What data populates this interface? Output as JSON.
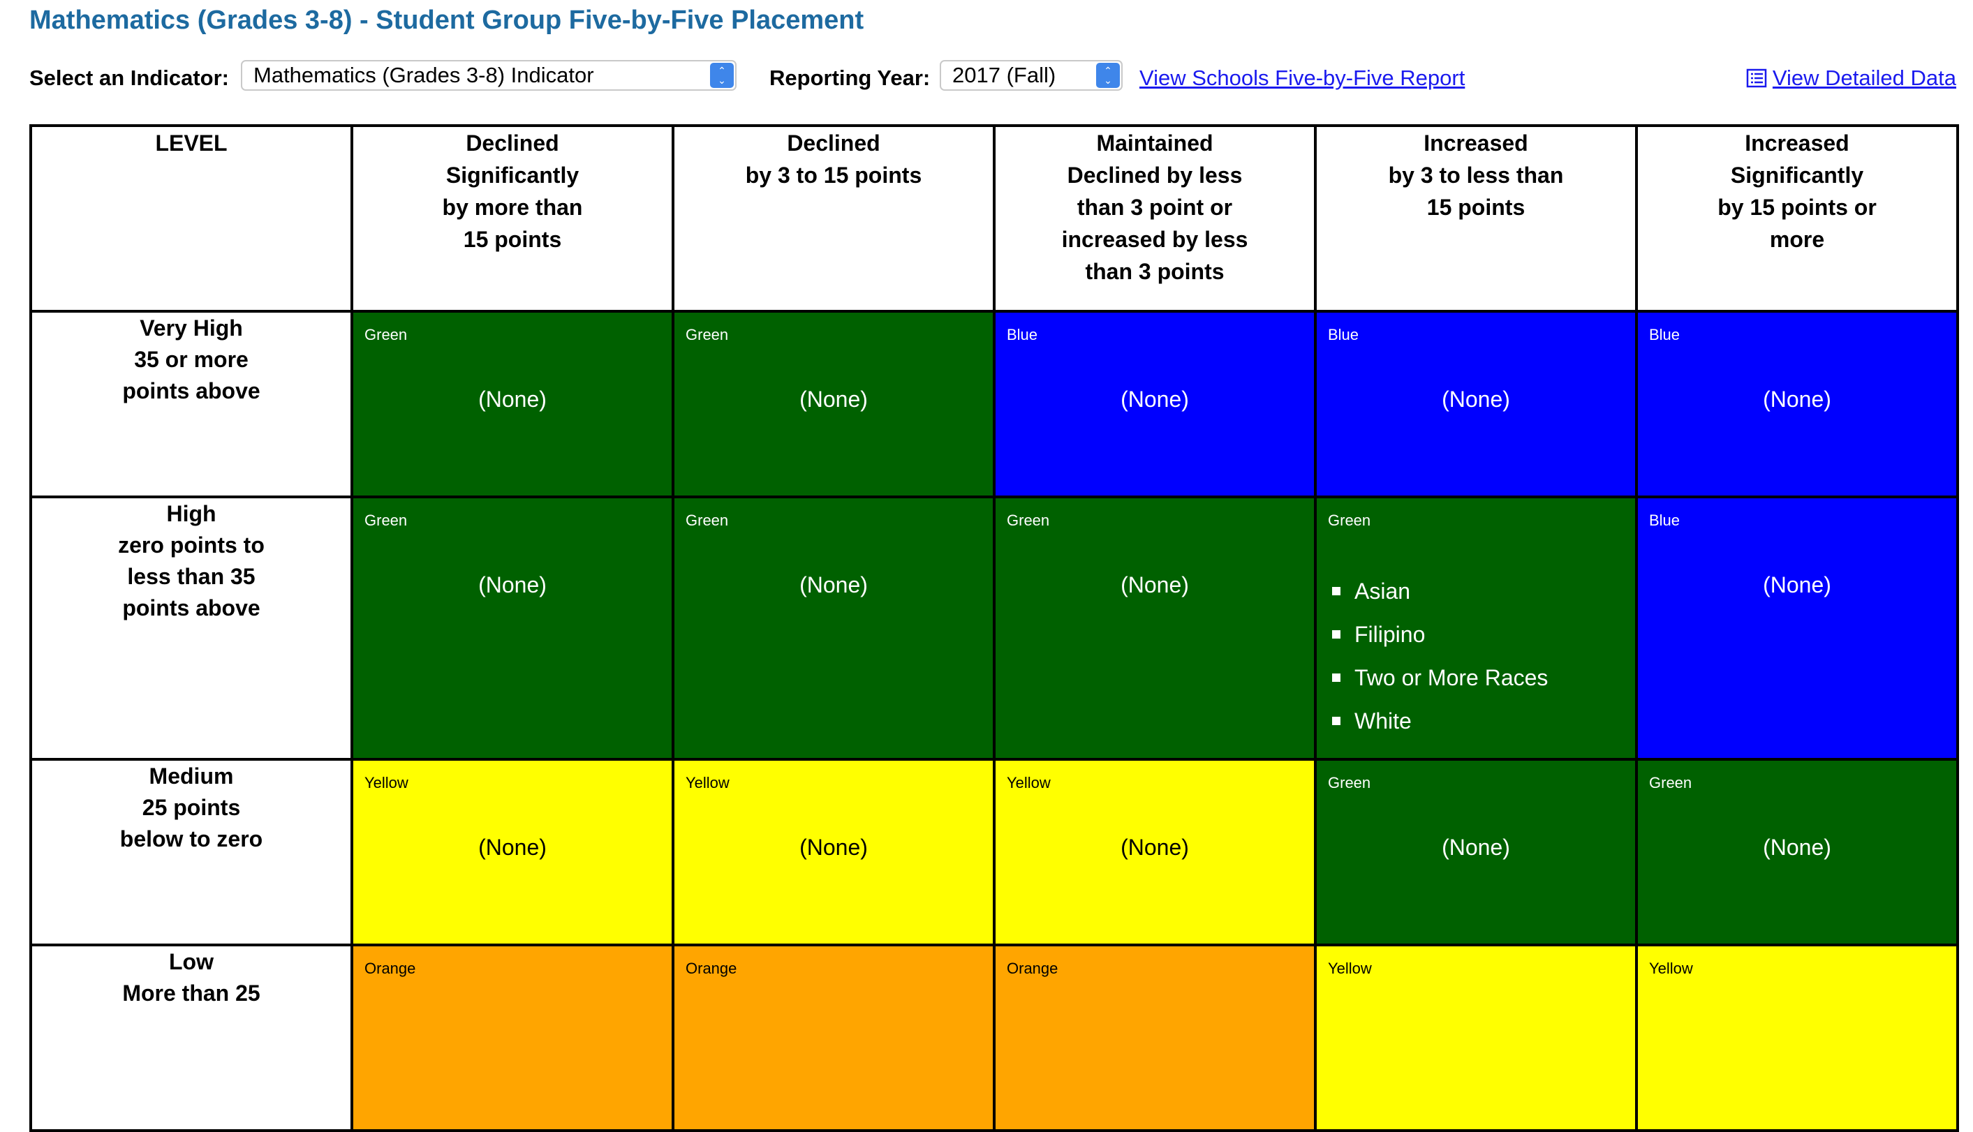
{
  "page_title": "Mathematics (Grades 3-8) - Student Group Five-by-Five Placement",
  "toolbar": {
    "indicator_label": "Select an Indicator:",
    "indicator_value": "Mathematics (Grades 3-8) Indicator",
    "year_label": "Reporting Year:",
    "year_value": "2017 (Fall)",
    "schools_report_link": "View Schools Five-by-Five Report",
    "detailed_data_link": "View Detailed Data"
  },
  "colors": {
    "Green": "#006100",
    "Blue": "#0000ff",
    "Yellow": "#ffff00",
    "Orange": "#ffa500",
    "title": "#1d6aa0",
    "link": "#1a1aee"
  },
  "table": {
    "level_header": "LEVEL",
    "columns": [
      "Declined\nSignificantly\nby more than\n15 points",
      "Declined\nby 3 to 15 points",
      "Maintained\nDeclined by less\nthan 3 point or\nincreased by less\nthan 3 points",
      "Increased\nby 3 to less than\n15 points",
      "Increased\nSignificantly\nby 15 points or\nmore"
    ],
    "rows": [
      {
        "level": "Very High\n35 or more\npoints above",
        "cells": [
          {
            "color": "Green",
            "value": "(None)"
          },
          {
            "color": "Green",
            "value": "(None)"
          },
          {
            "color": "Blue",
            "value": "(None)"
          },
          {
            "color": "Blue",
            "value": "(None)"
          },
          {
            "color": "Blue",
            "value": "(None)"
          }
        ]
      },
      {
        "level": "High\nzero points to\nless than 35\npoints above",
        "cells": [
          {
            "color": "Green",
            "value": "(None)"
          },
          {
            "color": "Green",
            "value": "(None)"
          },
          {
            "color": "Green",
            "value": "(None)"
          },
          {
            "color": "Green",
            "groups": [
              "Asian",
              "Filipino",
              "Two or More Races",
              "White"
            ]
          },
          {
            "color": "Blue",
            "value": "(None)"
          }
        ]
      },
      {
        "level": "Medium\n25 points\nbelow to zero",
        "cells": [
          {
            "color": "Yellow",
            "value": "(None)"
          },
          {
            "color": "Yellow",
            "value": "(None)"
          },
          {
            "color": "Yellow",
            "value": "(None)"
          },
          {
            "color": "Green",
            "value": "(None)"
          },
          {
            "color": "Green",
            "value": "(None)"
          }
        ]
      },
      {
        "level": "Low\nMore than 25",
        "cells": [
          {
            "color": "Orange"
          },
          {
            "color": "Orange"
          },
          {
            "color": "Orange"
          },
          {
            "color": "Yellow"
          },
          {
            "color": "Yellow"
          }
        ]
      }
    ]
  }
}
